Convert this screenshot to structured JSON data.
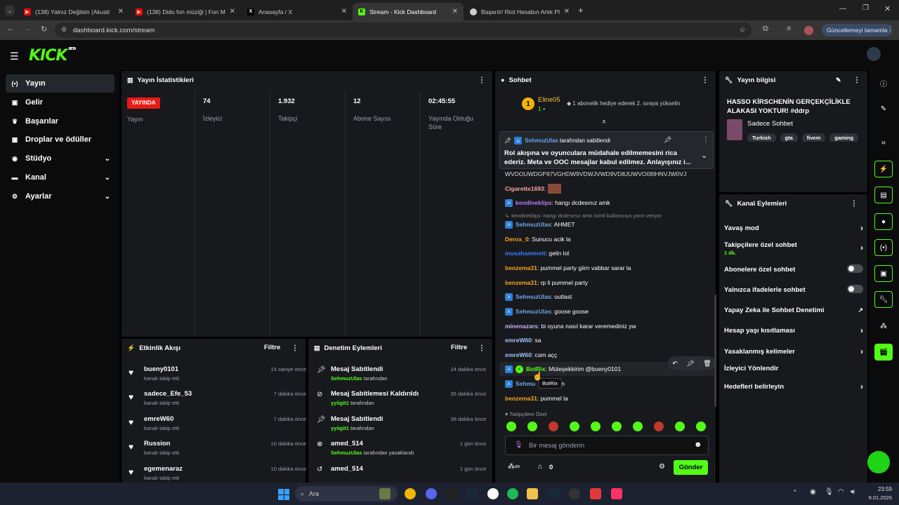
{
  "browser": {
    "tabs": [
      {
        "label": "(138) Yalnız Değilsin (Akusti",
        "fav_color": "#ff0000"
      },
      {
        "label": "(138) Dido fon müziği | Fon Mü",
        "fav_color": "#ff0000"
      },
      {
        "label": "Anasayfa / X",
        "fav_color": "#000000"
      },
      {
        "label": "Stream - Kick Dashboard",
        "fav_color": "#53fc18"
      },
      {
        "label": "Başarılı! Riot Hesabın Artık Platf",
        "fav_color": "#cccccc"
      }
    ],
    "url": "dashboard.kick.com/stream",
    "update_label": "Güncellemeyi tamamla"
  },
  "logo": {
    "text": "KICK",
    "badge": "BETA"
  },
  "sidebar": {
    "items": [
      {
        "label": "Yayın",
        "icon": "broadcast-icon"
      },
      {
        "label": "Gelir",
        "icon": "wallet-icon"
      },
      {
        "label": "Başarılar",
        "icon": "trophy-icon"
      },
      {
        "label": "Droplar ve ödüller",
        "icon": "gift-icon"
      },
      {
        "label": "Stüdyo",
        "icon": "studio-icon"
      },
      {
        "label": "Kanal",
        "icon": "channel-icon"
      },
      {
        "label": "Ayarlar",
        "icon": "gear-icon"
      }
    ]
  },
  "stats": {
    "title": "Yayın İstatistikleri",
    "live_badge": "YAYINDA",
    "live_label": "Yayın",
    "cols": [
      {
        "value": "74",
        "label": "İzleyici"
      },
      {
        "value": "1.932",
        "label": "Takipçi"
      },
      {
        "value": "12",
        "label": "Abone Sayısı"
      },
      {
        "value": "02:45:55",
        "label": "Yayında Olduğu Süre"
      }
    ]
  },
  "activity": {
    "title": "Etkinlik Akışı",
    "filter": "Filtre",
    "rows": [
      {
        "name": "bueny0101",
        "sub": "kanalı takip etti",
        "time": "15 saniye önce"
      },
      {
        "name": "sadece_Efe_53",
        "sub": "kanalı takip etti",
        "time": "7 dakika önce"
      },
      {
        "name": "emreW60",
        "sub": "kanalı takip etti",
        "time": "7 dakika önce"
      },
      {
        "name": "Russion",
        "sub": "kanalı takip etti",
        "time": "10 dakika önce"
      },
      {
        "name": "egemenaraz",
        "sub": "kanalı takip etti",
        "time": "10 dakika önce"
      }
    ]
  },
  "moderation": {
    "title": "Denetim Eylemleri",
    "filter": "Filtre",
    "rows": [
      {
        "icon": "pin-icon",
        "name": "Mesaj Sabitlendi",
        "who": "SehmuzUlas",
        "suffix": "tarafından",
        "time": "24 dakika önce"
      },
      {
        "icon": "unpin-icon",
        "name": "Mesaj Sabitlemesi Kaldırıldı",
        "who": "yyiigit1",
        "suffix": "tarafından",
        "time": "35 dakika önce"
      },
      {
        "icon": "pin-icon",
        "name": "Mesaj Sabitlendi",
        "who": "yyiigit1",
        "suffix": "tarafından",
        "time": "36 dakika önce"
      },
      {
        "icon": "ban-icon",
        "name": "amed_514",
        "who": "SehmuzUlas",
        "suffix": "tarafından yasaklandı",
        "time": "1 gün önce"
      },
      {
        "icon": "undo-icon",
        "name": "amed_514",
        "who": "",
        "suffix": "",
        "time": "1 gün önce"
      }
    ]
  },
  "chat": {
    "title": "Sohbet",
    "top_user": "Eline05",
    "top_rank": "1",
    "top_count": "1",
    "top_msg": "1 abonelik hediye ederek 2. sıraya yükselin",
    "pinned_by": "SehmuzUlas",
    "pinned_suffix": "tarafından sabitlendi",
    "pinned_text": "Rol akışına ve oyunculara müdahale edilmemesini rica ederiz. Meta ve OOC mesajlar kabul edilmez. Anlayışınız i...",
    "cut_line": "WVDOUWDGP97VGHDW9VDWJVWD9VD8JUWVO08IHNVJW0VJ",
    "messages": [
      {
        "user": "Cigarette1693",
        "text": "",
        "color": "#f5a3a3",
        "badge": false
      },
      {
        "user": "kendineklips",
        "text": ": hangı dcdesınız amk",
        "color": "#b47cf5",
        "badge": true
      },
      {
        "user": "",
        "text": "kendineklips: hangı dcdesınız amk isimli kullanıcıya yanıt veriyor",
        "color": "#888888",
        "badge": false,
        "reply": true
      },
      {
        "user": "SehmuzUlas",
        "text": ": AHMET",
        "color": "#6ba6e8",
        "badge": true
      },
      {
        "user": "Derox_0",
        "text": ": Sunucu acik la",
        "color": "#f5a623",
        "badge": false
      },
      {
        "user": "musahammett",
        "text": ": gelin lol",
        "color": "#3a7bff",
        "badge": false
      },
      {
        "user": "benzema31",
        "text": ": pummel party giirn vabbar sarar la",
        "color": "#f5a623",
        "badge": false
      },
      {
        "user": "benzema31",
        "text": ": rp li pummel party",
        "color": "#f5a623",
        "badge": false
      },
      {
        "user": "SehmuzUlas",
        "text": ": outlast",
        "color": "#6ba6e8",
        "badge": true
      },
      {
        "user": "SehmuzUlas",
        "text": ": goose goose",
        "color": "#6ba6e8",
        "badge": true
      },
      {
        "user": "minenazars",
        "text": ": bi oyuna nasıl karar veremediniz yw",
        "color": "#c9b3ff",
        "badge": false
      },
      {
        "user": "emreW60",
        "text": ": sa",
        "color": "#9ec6ff",
        "badge": false
      },
      {
        "user": "emreW60",
        "text": ": cam açç",
        "color": "#9ec6ff",
        "badge": false
      },
      {
        "user": "BotRix",
        "text": ": Müteşekkirim @bueny0101",
        "color": "#53fc18",
        "badge": true
      },
      {
        "user": "Sehmu",
        "text": "sign",
        "color": "#6ba6e8",
        "badge": true
      },
      {
        "user": "benzema31",
        "text": ": pummel la",
        "color": "#f5a623",
        "badge": false
      }
    ],
    "tooltip": "BotRix",
    "emote_label": "Takipçilere Özel",
    "input_placeholder": "Bir mesaj gönderin",
    "points": "0",
    "send": "Gönder"
  },
  "stream_info": {
    "title": "Yayın bilgisi",
    "stream_title": "HASSO KİRSCHENİN GERÇEKÇİLİKLE ALAKASI YOKTUR! #ddrp",
    "category": "Sadece Sohbet",
    "tags": [
      "Turkish",
      "gta",
      "fivem",
      "gaming"
    ]
  },
  "channel_actions": {
    "title": "Kanal Eylemleri",
    "rows": [
      {
        "label": "Yavaş mod",
        "control": "arrow",
        "sub": ""
      },
      {
        "label": "Takipçilere özel sohbet",
        "control": "arrow",
        "sub": "1 dk."
      },
      {
        "label": "Abonelere özel sohbet",
        "control": "toggle",
        "sub": ""
      },
      {
        "label": "Yalnızca ifadelerle sohbet",
        "control": "toggle",
        "sub": ""
      },
      {
        "label": "Yapay Zeka ile Sohbet Denetimi",
        "control": "external",
        "sub": ""
      },
      {
        "label": "Hesap yaşı kısıtlaması",
        "control": "arrow",
        "sub": ""
      },
      {
        "label": "Yasaklanmış kelimeler",
        "control": "arrow",
        "sub": ""
      },
      {
        "label": "İzleyici Yönlendir",
        "control": "",
        "sub": ""
      },
      {
        "label": "Hedefleri belirleyin",
        "control": "arrow",
        "sub": ""
      }
    ]
  },
  "taskbar": {
    "search": "Ara",
    "time": "23:59",
    "date": "9.01.2026"
  },
  "colors": {
    "accent": "#53fc18",
    "panel": "#18191c"
  }
}
